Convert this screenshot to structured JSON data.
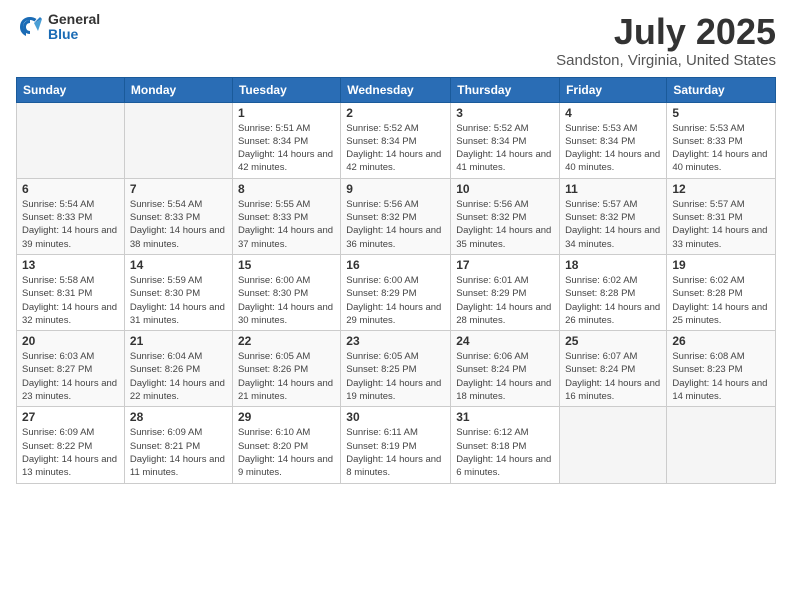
{
  "logo": {
    "general": "General",
    "blue": "Blue"
  },
  "title": "July 2025",
  "subtitle": "Sandston, Virginia, United States",
  "days_of_week": [
    "Sunday",
    "Monday",
    "Tuesday",
    "Wednesday",
    "Thursday",
    "Friday",
    "Saturday"
  ],
  "weeks": [
    [
      {
        "num": "",
        "info": ""
      },
      {
        "num": "",
        "info": ""
      },
      {
        "num": "1",
        "info": "Sunrise: 5:51 AM\nSunset: 8:34 PM\nDaylight: 14 hours and 42 minutes."
      },
      {
        "num": "2",
        "info": "Sunrise: 5:52 AM\nSunset: 8:34 PM\nDaylight: 14 hours and 42 minutes."
      },
      {
        "num": "3",
        "info": "Sunrise: 5:52 AM\nSunset: 8:34 PM\nDaylight: 14 hours and 41 minutes."
      },
      {
        "num": "4",
        "info": "Sunrise: 5:53 AM\nSunset: 8:34 PM\nDaylight: 14 hours and 40 minutes."
      },
      {
        "num": "5",
        "info": "Sunrise: 5:53 AM\nSunset: 8:33 PM\nDaylight: 14 hours and 40 minutes."
      }
    ],
    [
      {
        "num": "6",
        "info": "Sunrise: 5:54 AM\nSunset: 8:33 PM\nDaylight: 14 hours and 39 minutes."
      },
      {
        "num": "7",
        "info": "Sunrise: 5:54 AM\nSunset: 8:33 PM\nDaylight: 14 hours and 38 minutes."
      },
      {
        "num": "8",
        "info": "Sunrise: 5:55 AM\nSunset: 8:33 PM\nDaylight: 14 hours and 37 minutes."
      },
      {
        "num": "9",
        "info": "Sunrise: 5:56 AM\nSunset: 8:32 PM\nDaylight: 14 hours and 36 minutes."
      },
      {
        "num": "10",
        "info": "Sunrise: 5:56 AM\nSunset: 8:32 PM\nDaylight: 14 hours and 35 minutes."
      },
      {
        "num": "11",
        "info": "Sunrise: 5:57 AM\nSunset: 8:32 PM\nDaylight: 14 hours and 34 minutes."
      },
      {
        "num": "12",
        "info": "Sunrise: 5:57 AM\nSunset: 8:31 PM\nDaylight: 14 hours and 33 minutes."
      }
    ],
    [
      {
        "num": "13",
        "info": "Sunrise: 5:58 AM\nSunset: 8:31 PM\nDaylight: 14 hours and 32 minutes."
      },
      {
        "num": "14",
        "info": "Sunrise: 5:59 AM\nSunset: 8:30 PM\nDaylight: 14 hours and 31 minutes."
      },
      {
        "num": "15",
        "info": "Sunrise: 6:00 AM\nSunset: 8:30 PM\nDaylight: 14 hours and 30 minutes."
      },
      {
        "num": "16",
        "info": "Sunrise: 6:00 AM\nSunset: 8:29 PM\nDaylight: 14 hours and 29 minutes."
      },
      {
        "num": "17",
        "info": "Sunrise: 6:01 AM\nSunset: 8:29 PM\nDaylight: 14 hours and 28 minutes."
      },
      {
        "num": "18",
        "info": "Sunrise: 6:02 AM\nSunset: 8:28 PM\nDaylight: 14 hours and 26 minutes."
      },
      {
        "num": "19",
        "info": "Sunrise: 6:02 AM\nSunset: 8:28 PM\nDaylight: 14 hours and 25 minutes."
      }
    ],
    [
      {
        "num": "20",
        "info": "Sunrise: 6:03 AM\nSunset: 8:27 PM\nDaylight: 14 hours and 23 minutes."
      },
      {
        "num": "21",
        "info": "Sunrise: 6:04 AM\nSunset: 8:26 PM\nDaylight: 14 hours and 22 minutes."
      },
      {
        "num": "22",
        "info": "Sunrise: 6:05 AM\nSunset: 8:26 PM\nDaylight: 14 hours and 21 minutes."
      },
      {
        "num": "23",
        "info": "Sunrise: 6:05 AM\nSunset: 8:25 PM\nDaylight: 14 hours and 19 minutes."
      },
      {
        "num": "24",
        "info": "Sunrise: 6:06 AM\nSunset: 8:24 PM\nDaylight: 14 hours and 18 minutes."
      },
      {
        "num": "25",
        "info": "Sunrise: 6:07 AM\nSunset: 8:24 PM\nDaylight: 14 hours and 16 minutes."
      },
      {
        "num": "26",
        "info": "Sunrise: 6:08 AM\nSunset: 8:23 PM\nDaylight: 14 hours and 14 minutes."
      }
    ],
    [
      {
        "num": "27",
        "info": "Sunrise: 6:09 AM\nSunset: 8:22 PM\nDaylight: 14 hours and 13 minutes."
      },
      {
        "num": "28",
        "info": "Sunrise: 6:09 AM\nSunset: 8:21 PM\nDaylight: 14 hours and 11 minutes."
      },
      {
        "num": "29",
        "info": "Sunrise: 6:10 AM\nSunset: 8:20 PM\nDaylight: 14 hours and 9 minutes."
      },
      {
        "num": "30",
        "info": "Sunrise: 6:11 AM\nSunset: 8:19 PM\nDaylight: 14 hours and 8 minutes."
      },
      {
        "num": "31",
        "info": "Sunrise: 6:12 AM\nSunset: 8:18 PM\nDaylight: 14 hours and 6 minutes."
      },
      {
        "num": "",
        "info": ""
      },
      {
        "num": "",
        "info": ""
      }
    ]
  ]
}
